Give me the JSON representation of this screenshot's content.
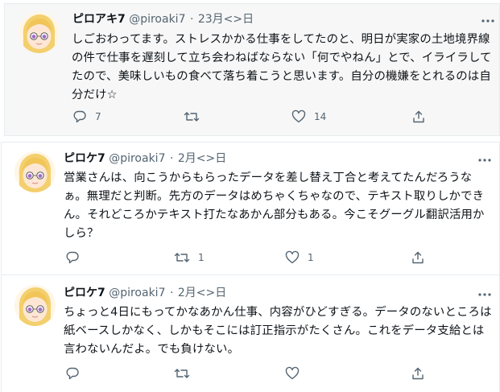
{
  "tweets": [
    {
      "name": "ピロアキ7",
      "handle": "@piroaki7",
      "separator": "·",
      "date": "23月<>日",
      "text": "しごおわってます。ストレスかかる仕事をしてたのと、明日が実家の土地境界線の件で仕事を遅刻して立ち会わねばならない「何でやねん」とで、イライラしてたので、美味しいもの食べて落ち着こうと思います。自分の機嫌をとれるのは自分だけ☆",
      "reply_count": "7",
      "retweet_count": "",
      "like_count": "14"
    },
    {
      "name": "ピロケ7",
      "handle": "@piroaki7",
      "separator": "·",
      "date": "2月<>日",
      "text": "営業さんは、向こうからもらったデータを差し替え丁合と考えてたんだろうなぁ。無理だと判断。先方のデータはめちゃくちゃなので、テキスト取りしかできん。それどころかテキスト打たなあかん部分もある。今こそグーグル翻訳活用かしら？",
      "reply_count": "",
      "retweet_count": "1",
      "like_count": "1"
    },
    {
      "name": "ピロケ7",
      "handle": "@piroaki7",
      "separator": "·",
      "date": "2月<>日",
      "text": "ちょっと4日にもってかなあかん仕事、内容がひどすぎる。データのないところは紙ベースしかなく、しかもそこには訂正指示がたくさん。これをデータ支給とは言わないんだよ。でも負けない。",
      "reply_count": "",
      "retweet_count": "",
      "like_count": ""
    }
  ],
  "icons": {
    "reply": "reply-icon",
    "retweet": "retweet-icon",
    "like": "heart-icon",
    "share": "share-icon",
    "more": "more-dots-icon"
  },
  "colors": {
    "text": "#0f1419",
    "muted": "#536471",
    "border": "#e6ecf0",
    "highlight_bg": "#f7f7f7"
  }
}
